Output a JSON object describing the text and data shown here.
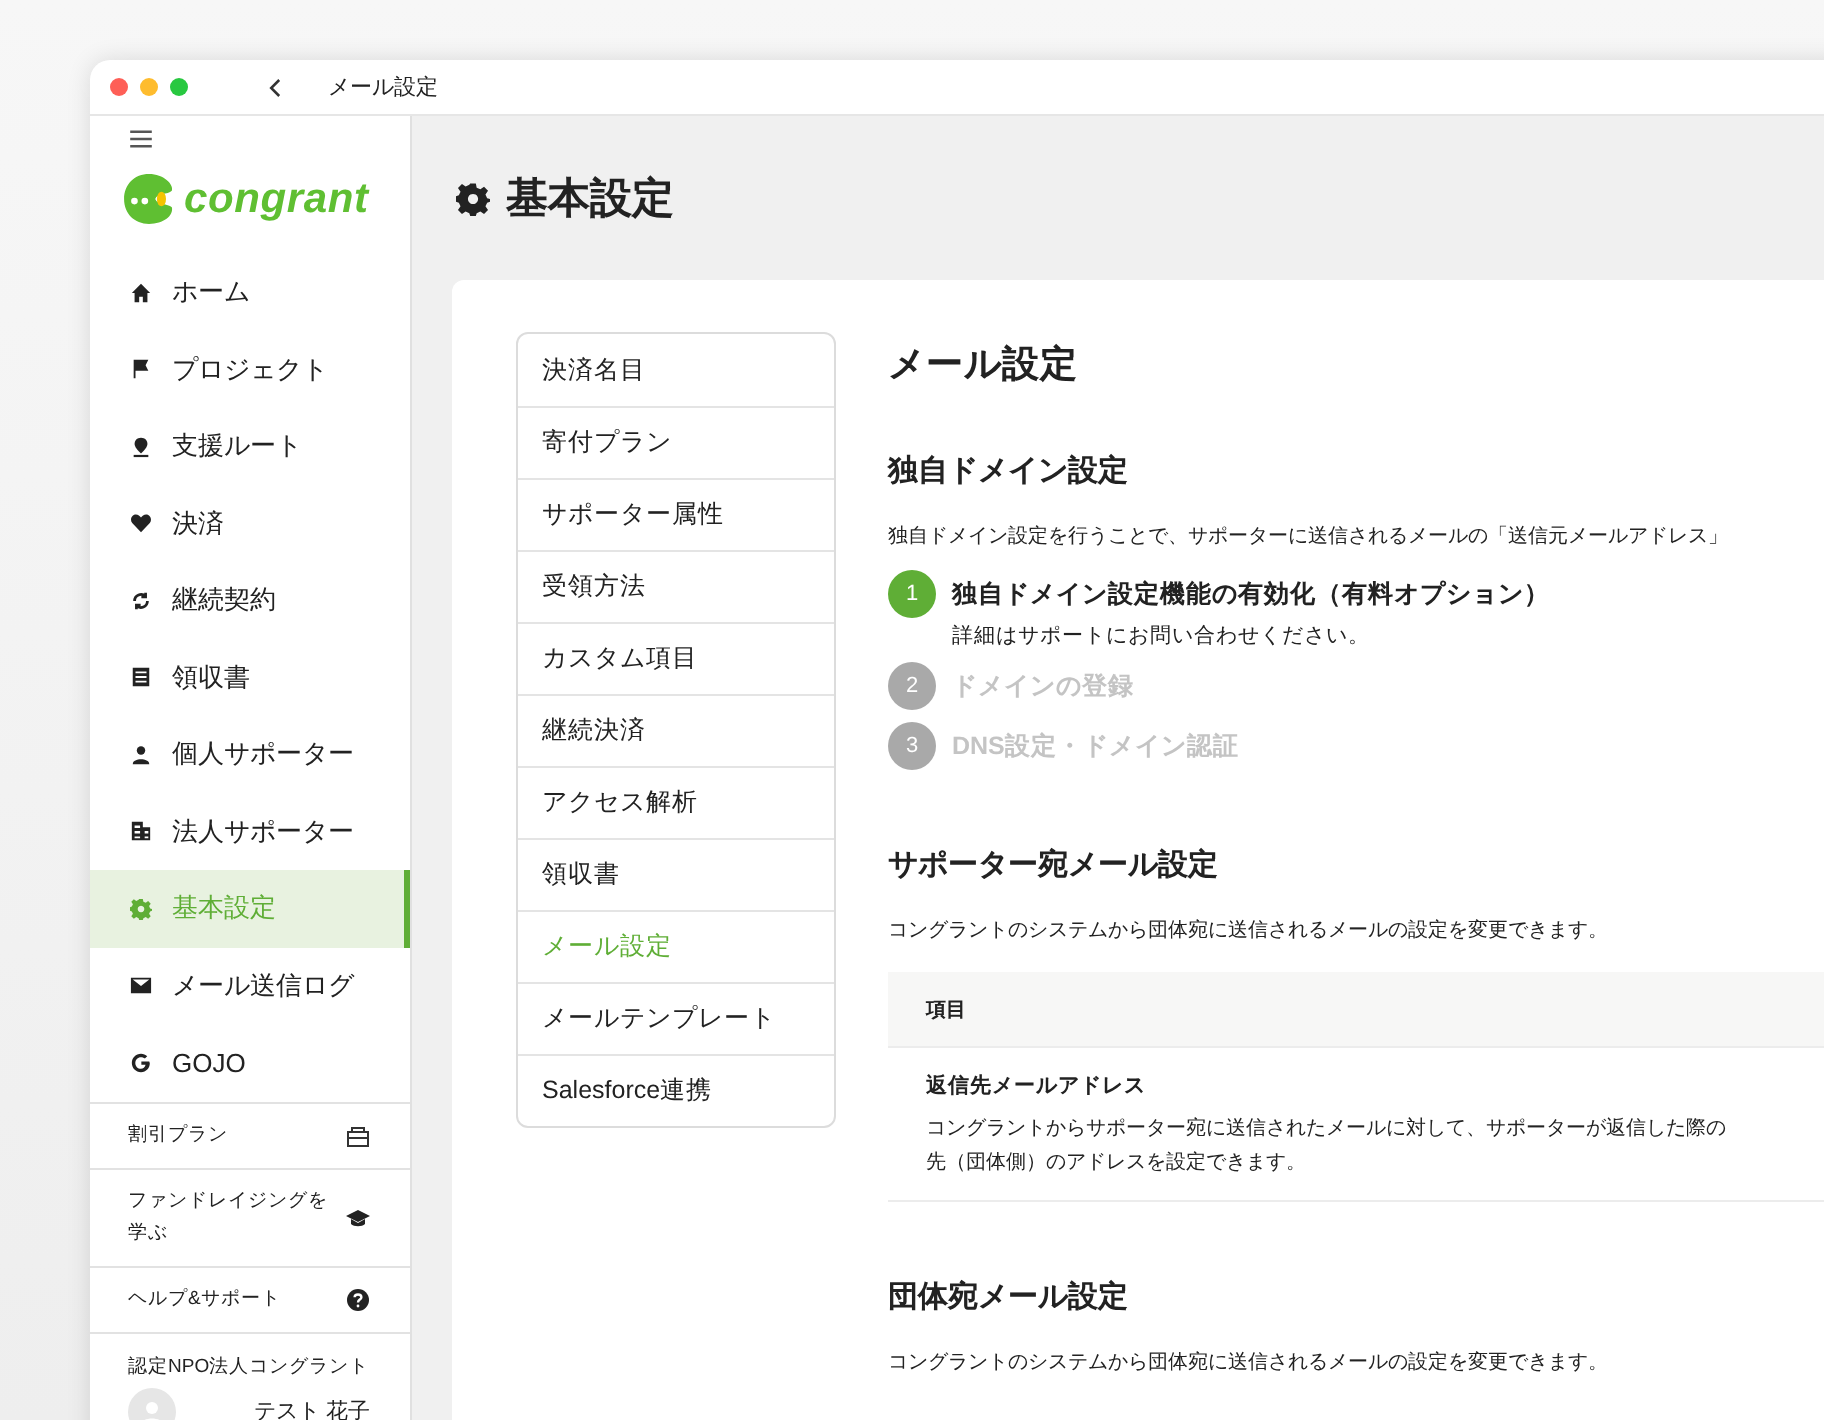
{
  "window": {
    "title": "メール設定"
  },
  "sidebar": {
    "logo": "congrant",
    "items": [
      {
        "label": "ホーム",
        "selected": false
      },
      {
        "label": "プロジェクト",
        "selected": false
      },
      {
        "label": "支援ルート",
        "selected": false
      },
      {
        "label": "決済",
        "selected": false
      },
      {
        "label": "継続契約",
        "selected": false
      },
      {
        "label": "領収書",
        "selected": false
      },
      {
        "label": "個人サポーター",
        "selected": false
      },
      {
        "label": "法人サポーター",
        "selected": false
      },
      {
        "label": "基本設定",
        "selected": true
      },
      {
        "label": "メール送信ログ",
        "selected": false
      },
      {
        "label": "GOJO",
        "selected": false
      }
    ],
    "links": [
      {
        "label": "割引プラン"
      },
      {
        "label": "ファンドレイジングを学ぶ"
      },
      {
        "label": "ヘルプ&サポート"
      }
    ],
    "account": {
      "organization": "認定NPO法人コングラント",
      "user": "テスト 花子"
    }
  },
  "page_title": "基本設定",
  "subnav": [
    {
      "label": "決済名目",
      "selected": false
    },
    {
      "label": "寄付プラン",
      "selected": false
    },
    {
      "label": "サポーター属性",
      "selected": false
    },
    {
      "label": "受領方法",
      "selected": false
    },
    {
      "label": "カスタム項目",
      "selected": false
    },
    {
      "label": "継続決済",
      "selected": false
    },
    {
      "label": "アクセス解析",
      "selected": false
    },
    {
      "label": "領収書",
      "selected": false
    },
    {
      "label": "メール設定",
      "selected": true
    },
    {
      "label": "メールテンプレート",
      "selected": false
    },
    {
      "label": "Salesforce連携",
      "selected": false
    }
  ],
  "content": {
    "title": "メール設定",
    "domain": {
      "heading": "独自ドメイン設定",
      "intro": "独自ドメイン設定を行うことで、サポーターに送信されるメールの「送信元メールアドレス」",
      "steps": [
        {
          "number": "1",
          "title": "独自ドメイン設定機能の有効化（有料オプション）",
          "note": "詳細はサポートにお問い合わせください。",
          "active": true
        },
        {
          "number": "2",
          "title": "ドメインの登録",
          "active": false
        },
        {
          "number": "3",
          "title": "DNS設定・ドメイン認証",
          "active": false
        }
      ]
    },
    "supporter_mail": {
      "heading": "サポーター宛メール設定",
      "intro": "コングラントのシステムから団体宛に送信されるメールの設定を変更できます。",
      "table": {
        "column": "項目",
        "rows": [
          {
            "name": "返信先メールアドレス",
            "description": [
              "コングラントからサポーター宛に送信されたメールに対して、サポーターが返信した際の",
              "先（団体側）のアドレスを設定できます。"
            ]
          }
        ]
      }
    },
    "org_mail": {
      "heading": "団体宛メール設定",
      "intro": "コングラントのシステムから団体宛に送信されるメールの設定を変更できます。"
    }
  }
}
